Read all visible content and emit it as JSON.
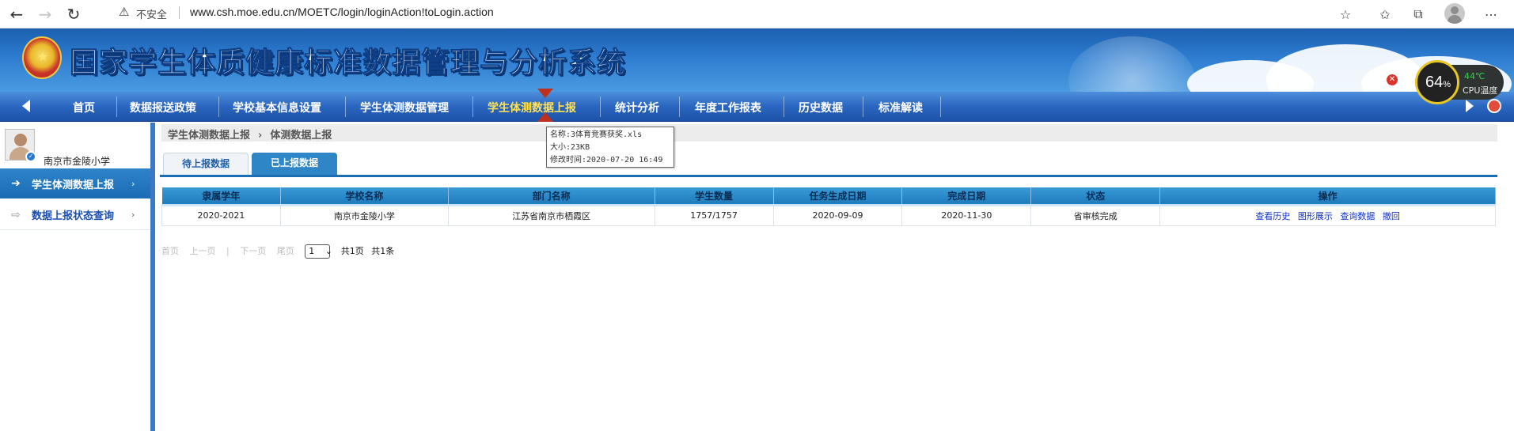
{
  "browser": {
    "security_label": "不安全",
    "url": "www.csh.moe.edu.cn/MOETC/login/loginAction!toLogin.action"
  },
  "header": {
    "title": "国家学生体质健康标准数据管理与分析系统"
  },
  "nav": {
    "items": [
      {
        "label": "首页"
      },
      {
        "label": "数据报送政策"
      },
      {
        "label": "学校基本信息设置"
      },
      {
        "label": "学生体测数据管理"
      },
      {
        "label": "学生体测数据上报",
        "active": true
      },
      {
        "label": "统计分析"
      },
      {
        "label": "年度工作报表"
      },
      {
        "label": "历史数据"
      },
      {
        "label": "标准解读"
      }
    ]
  },
  "cpu_widget": {
    "percent": "64",
    "percent_unit": "%",
    "temperature": "44℃",
    "label": "CPU温度"
  },
  "sidebar": {
    "school_name": "南京市金陵小学",
    "items": [
      {
        "label": "学生体测数据上报",
        "active": true
      },
      {
        "label": "数据上报状态查询",
        "active": false
      }
    ]
  },
  "breadcrumb": {
    "parent": "学生体测数据上报",
    "current": "体测数据上报"
  },
  "tabs": {
    "pending": "待上报数据",
    "reported": "已上报数据"
  },
  "table": {
    "headers": [
      "隶属学年",
      "学校名称",
      "部门名称",
      "学生数量",
      "任务生成日期",
      "完成日期",
      "状态",
      "操作"
    ],
    "rows": [
      {
        "year": "2020-2021",
        "school": "南京市金陵小学",
        "department": "江苏省南京市栖霞区",
        "students": "1757/1757",
        "created": "2020-09-09",
        "completed": "2020-11-30",
        "status": "省审核完成",
        "actions": [
          "查看历史",
          "图形展示",
          "查询数据",
          "撤回"
        ]
      }
    ]
  },
  "pager": {
    "first": "首页",
    "prev": "上一页",
    "separator": "|",
    "next": "下一页",
    "last": "尾页",
    "page_value": "1",
    "total_pages": "共1页",
    "total_records": "共1条"
  },
  "tooltip": {
    "name_line": "名称:3体育竞赛获奖.xls",
    "size_line": "大小:23KB",
    "modified_line": "修改时间:2020-07-20 16:49"
  }
}
